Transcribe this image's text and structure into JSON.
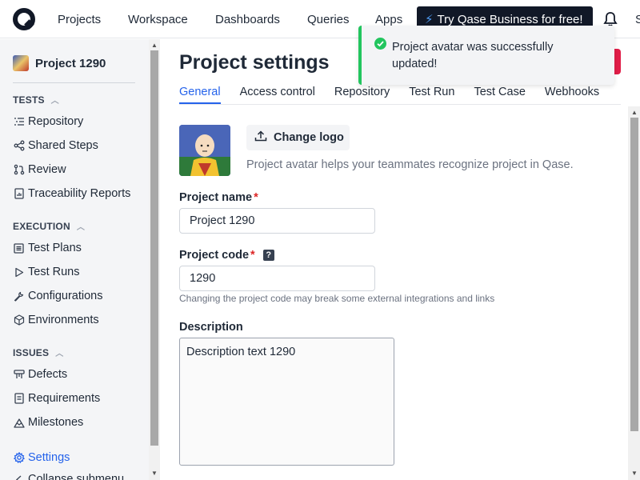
{
  "nav": {
    "items": [
      "Projects",
      "Workspace",
      "Dashboards",
      "Queries",
      "Apps"
    ],
    "promo_label": "Try Qase Business for free!",
    "cut_item": "S"
  },
  "sidebar": {
    "project_name": "Project 1290",
    "sections": [
      {
        "title": "TESTS",
        "items": [
          "Repository",
          "Shared Steps",
          "Review",
          "Traceability Reports"
        ]
      },
      {
        "title": "EXECUTION",
        "items": [
          "Test Plans",
          "Test Runs",
          "Configurations",
          "Environments"
        ]
      },
      {
        "title": "ISSUES",
        "items": [
          "Defects",
          "Requirements",
          "Milestones"
        ]
      }
    ],
    "settings_label": "Settings",
    "collapse_label": "Collapse submenu"
  },
  "main": {
    "title": "Project settings",
    "tabs": [
      "General",
      "Access control",
      "Repository",
      "Test Run",
      "Test Case",
      "Webhooks"
    ],
    "change_logo_label": "Change logo",
    "logo_help": "Project avatar helps your teammates recognize project in Qase.",
    "project_name_label": "Project name",
    "project_name_value": "Project 1290",
    "project_code_label": "Project code",
    "project_code_value": "1290",
    "project_code_help_glyph": "?",
    "code_hint": "Changing the project code may break some external integrations and links",
    "description_label": "Description",
    "description_value": "Description text 1290",
    "required_mark": "*"
  },
  "toast": {
    "message": "Project avatar was successfully updated!",
    "status_color": "#22c55e"
  },
  "colors": {
    "accent": "#2563eb",
    "danger": "#dc2626",
    "promo_bg": "#111827"
  }
}
